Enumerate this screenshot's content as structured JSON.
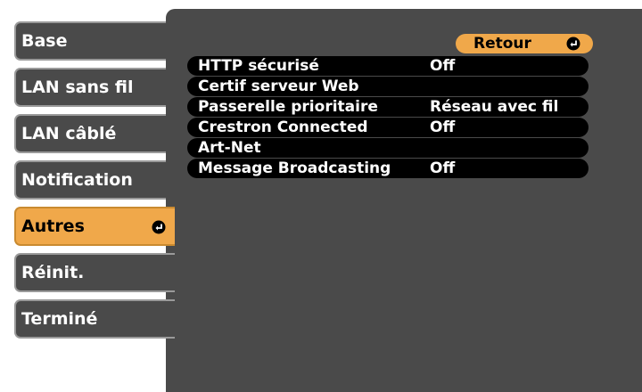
{
  "sidebar": {
    "items": [
      {
        "label": "Base"
      },
      {
        "label": "LAN sans fil"
      },
      {
        "label": "LAN câblé"
      },
      {
        "label": "Notification"
      },
      {
        "label": "Autres"
      },
      {
        "label": "Réinit."
      },
      {
        "label": "Terminé"
      }
    ],
    "active_index": 4
  },
  "panel": {
    "back_label": "Retour",
    "rows": [
      {
        "label": "HTTP sécurisé",
        "value": "Off"
      },
      {
        "label": "Certif serveur Web",
        "value": ""
      },
      {
        "label": "Passerelle prioritaire",
        "value": "Réseau avec fil"
      },
      {
        "label": "Crestron Connected",
        "value": "Off"
      },
      {
        "label": "Art-Net",
        "value": ""
      },
      {
        "label": "Message Broadcasting",
        "value": "Off"
      }
    ]
  },
  "colors": {
    "accent": "#f0a84a",
    "panel_bg": "#4a4a4a",
    "row_bg": "#000000"
  },
  "icons": {
    "enter": "enter-icon"
  }
}
